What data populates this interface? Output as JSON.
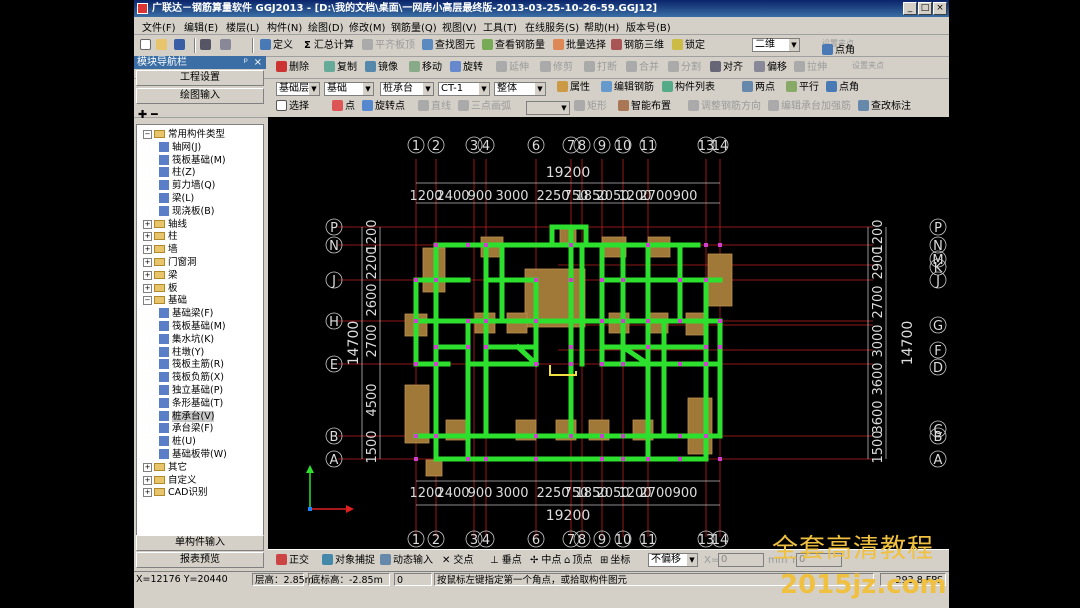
{
  "window": {
    "title": "广联达－钢筋算量软件 GGJ2013 - [D:\\我的文档\\桌面\\一网房小高层最终版-2013-03-25-10-26-59.GGJ12]",
    "min": "_",
    "max": "□",
    "close": "×"
  },
  "menu": [
    "文件(F)",
    "编辑(E)",
    "楼层(L)",
    "构件(N)",
    "绘图(D)",
    "修改(M)",
    "钢筋量(Q)",
    "视图(V)",
    "工具(T)",
    "在线服务(S)",
    "帮助(H)",
    "版本号(B)"
  ],
  "toolbar1": {
    "define": "定义",
    "sum": "汇总计算",
    "flat": "平齐板顶",
    "find": "查找图元",
    "view_rebar": "查看钢筋量",
    "batch": "批量选择",
    "rebar3d": "钢筋三维",
    "lock": "锁定",
    "view_mode": "二维",
    "right1": "设置夹点",
    "right2": "点角"
  },
  "toolbar2": {
    "delete": "删除",
    "copy": "复制",
    "mirror": "镜像",
    "move": "移动",
    "rotate": "旋转",
    "extend": "延伸",
    "trim": "修剪",
    "break": "打断",
    "merge": "合并",
    "split": "分割",
    "align": "对齐",
    "offset": "偏移",
    "stretch": "拉伸",
    "right1": "设置夹点",
    "right2": "点角"
  },
  "toolbar3": {
    "floor": "基础层",
    "type": "基础",
    "comp": "桩承台",
    "name": "CT-1",
    "part": "整体",
    "attr": "属性",
    "edit_rebar": "编辑钢筋",
    "comp_list": "构件列表",
    "two_point": "两点",
    "parallel": "平行",
    "point_angle": "点角"
  },
  "toolbar4": {
    "select": "选择",
    "point": "点",
    "rotate_point": "旋转点",
    "line": "直线",
    "arc": "三点画弧",
    "rect": "矩形",
    "smart": "智能布置",
    "adjust": "调整钢筋方向",
    "edit_cap": "编辑承台加强筋",
    "check": "查改标注"
  },
  "nav": {
    "header": "模块导航栏",
    "pin": "ᵖ",
    "close": "×",
    "project_settings": "工程设置",
    "drawing_input": "绘图输入",
    "single_input": "单构件输入",
    "report": "报表预览",
    "tree": [
      {
        "label": "常用构件类型",
        "level": 0,
        "exp": "−",
        "kind": "folder"
      },
      {
        "label": "轴网(J)",
        "level": 1,
        "kind": "comp"
      },
      {
        "label": "筏板基础(M)",
        "level": 1,
        "kind": "comp"
      },
      {
        "label": "柱(Z)",
        "level": 1,
        "kind": "comp"
      },
      {
        "label": "剪力墙(Q)",
        "level": 1,
        "kind": "comp"
      },
      {
        "label": "梁(L)",
        "level": 1,
        "kind": "comp"
      },
      {
        "label": "现浇板(B)",
        "level": 1,
        "kind": "comp"
      },
      {
        "label": "轴线",
        "level": 0,
        "exp": "+",
        "kind": "folder"
      },
      {
        "label": "柱",
        "level": 0,
        "exp": "+",
        "kind": "folder"
      },
      {
        "label": "墙",
        "level": 0,
        "exp": "+",
        "kind": "folder"
      },
      {
        "label": "门窗洞",
        "level": 0,
        "exp": "+",
        "kind": "folder"
      },
      {
        "label": "梁",
        "level": 0,
        "exp": "+",
        "kind": "folder"
      },
      {
        "label": "板",
        "level": 0,
        "exp": "+",
        "kind": "folder"
      },
      {
        "label": "基础",
        "level": 0,
        "exp": "−",
        "kind": "folder"
      },
      {
        "label": "基础梁(F)",
        "level": 1,
        "kind": "comp"
      },
      {
        "label": "筏板基础(M)",
        "level": 1,
        "kind": "comp"
      },
      {
        "label": "集水坑(K)",
        "level": 1,
        "kind": "comp"
      },
      {
        "label": "柱墩(Y)",
        "level": 1,
        "kind": "comp"
      },
      {
        "label": "筏板主筋(R)",
        "level": 1,
        "kind": "comp"
      },
      {
        "label": "筏板负筋(X)",
        "level": 1,
        "kind": "comp"
      },
      {
        "label": "独立基础(P)",
        "level": 1,
        "kind": "comp"
      },
      {
        "label": "条形基础(T)",
        "level": 1,
        "kind": "comp"
      },
      {
        "label": "桩承台(V)",
        "level": 1,
        "kind": "comp",
        "selected": true
      },
      {
        "label": "承台梁(F)",
        "level": 1,
        "kind": "comp"
      },
      {
        "label": "桩(U)",
        "level": 1,
        "kind": "comp"
      },
      {
        "label": "基础板带(W)",
        "level": 1,
        "kind": "comp"
      },
      {
        "label": "其它",
        "level": 0,
        "exp": "+",
        "kind": "folder"
      },
      {
        "label": "自定义",
        "level": 0,
        "exp": "+",
        "kind": "folder"
      },
      {
        "label": "CAD识别",
        "level": 0,
        "exp": "+",
        "kind": "folder"
      }
    ]
  },
  "drawing": {
    "top_axes": [
      "1",
      "2",
      "3",
      "4",
      "6",
      "7",
      "8",
      "9",
      "10",
      "11",
      "13",
      "14"
    ],
    "total_width": "19200",
    "spans": [
      "1200",
      "2400",
      "900",
      "3000",
      "2250",
      "750",
      "1850",
      "2050",
      "1200",
      "2700",
      "900"
    ],
    "left_axes": [
      "P",
      "N",
      "J",
      "H",
      "E",
      "B",
      "A"
    ],
    "left_spans": [
      "1200",
      "2200",
      "2600",
      "2700",
      "4500",
      "1500"
    ],
    "total_height": "14700",
    "right_axes": [
      "P",
      "N",
      "M",
      "K",
      "J",
      "G",
      "F",
      "D",
      "C",
      "B",
      "A"
    ],
    "right_spans": [
      "1200",
      "2900",
      "2700",
      "3000",
      "3600",
      "3600",
      "1500"
    ]
  },
  "snapbar": {
    "ortho": "正交",
    "osnap": "对象捕捉",
    "dyn": "动态输入",
    "intersect": "交点",
    "perp": "垂点",
    "mid": "中点",
    "vertex": "顶点",
    "coord": "坐标",
    "offset": "不偏移",
    "x_label": "X=",
    "x_val": "0",
    "y_label": "mm Y=",
    "y_val": "0"
  },
  "status": {
    "coords": "X=12176 Y=20440",
    "floor_h": "层高：2.85m",
    "bottom_h": "底标高：-2.85m",
    "zero": "0",
    "hint": "按鼠标左键指定第一个角点，或拾取构件图元",
    "fps": "293.8 FPS"
  },
  "watermark": {
    "line1": "全套高清教程",
    "line2": "2015jz.com"
  },
  "colors": {
    "beam": "#2ee02e",
    "cap": "#a07838",
    "grid": "#c02020",
    "title_bg": "#0a246a"
  }
}
